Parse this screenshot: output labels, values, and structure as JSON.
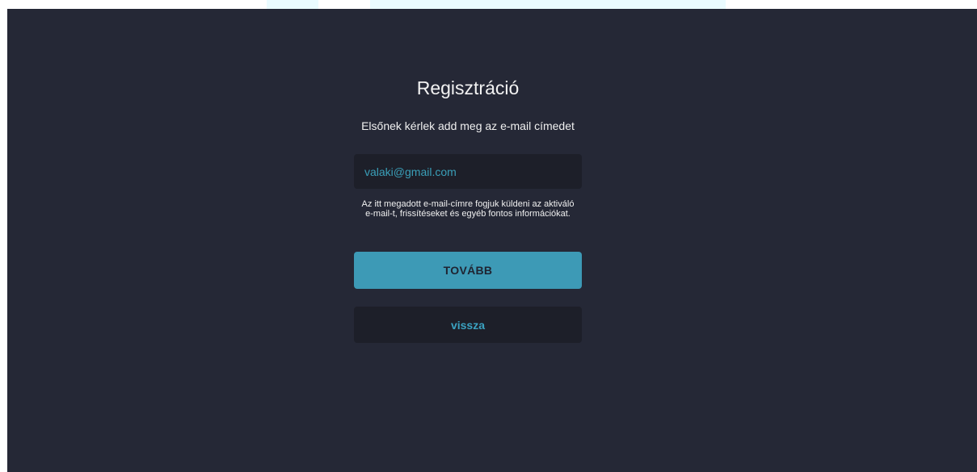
{
  "registration": {
    "title": "Regisztráció",
    "subtitle": "Elsőnek kérlek add meg az e-mail címedet",
    "email_placeholder": "valaki@gmail.com",
    "email_value": "",
    "hint": "Az itt megadott e-mail-címre fogjuk küldeni az aktiváló e-mail-t, frissítéseket és egyéb fontos információkat.",
    "next_label": "TOVÁBB",
    "back_label": "vissza"
  },
  "colors": {
    "background": "#252836",
    "field_background": "#1d1f29",
    "accent": "#3d9ab6",
    "accent_text": "#3aa2c1",
    "text": "#f2f2f2"
  }
}
